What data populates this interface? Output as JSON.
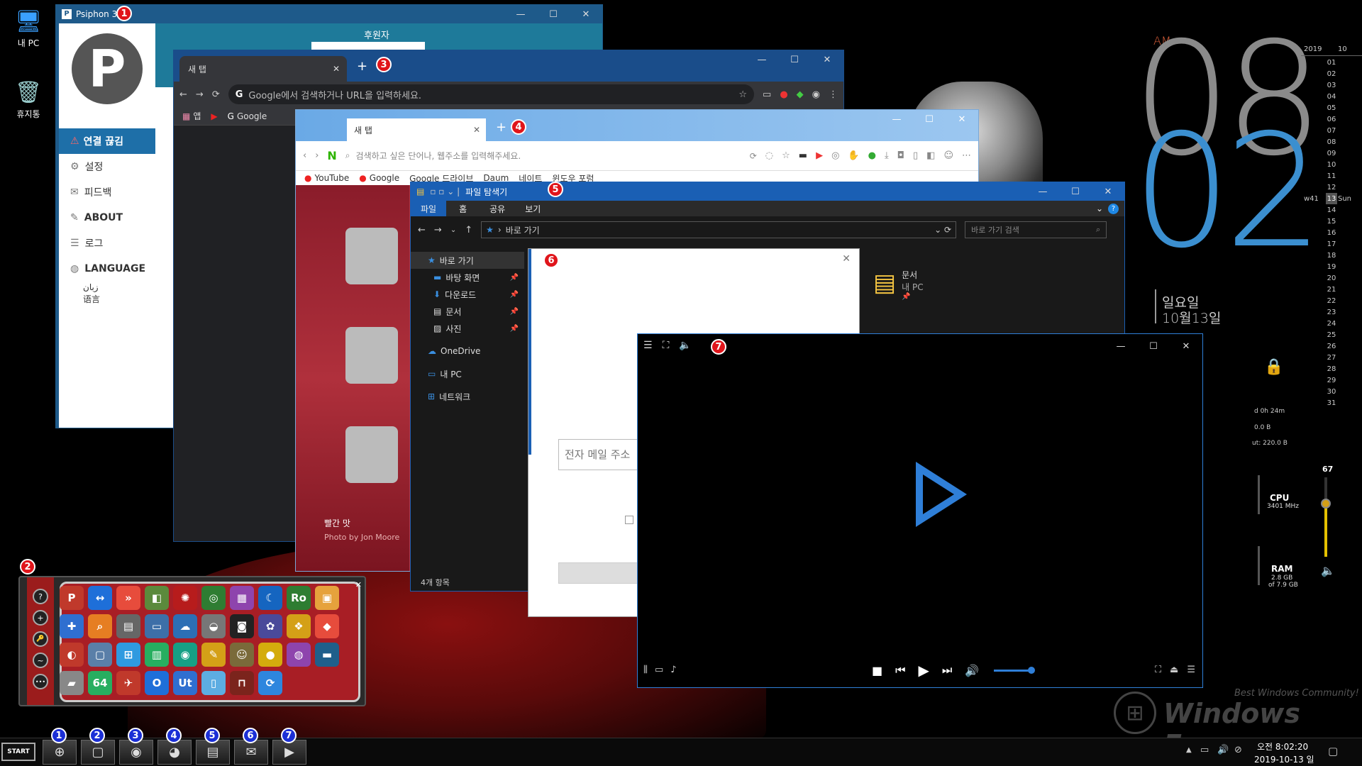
{
  "desktop": {
    "icons": [
      {
        "label": "내 PC",
        "icon": "monitor-icon"
      },
      {
        "label": "휴지통",
        "icon": "recycle-bin-icon"
      }
    ],
    "watermark": "Windows Forum",
    "watermark_sub": "Best Windows Community!"
  },
  "clock_widget": {
    "ampm": "AM",
    "hour": "08",
    "minute": "02",
    "weekday": "일요일",
    "date": "10월13일",
    "hour_color": "#8a8a8a",
    "minute_color": "#3b8fd0"
  },
  "calendar": {
    "year": "2019",
    "month": "10",
    "week": "w41",
    "today": "13",
    "today_name": "Sun",
    "days": [
      "01",
      "02",
      "03",
      "04",
      "05",
      "06",
      "07",
      "08",
      "09",
      "10",
      "11",
      "12",
      "13",
      "14",
      "15",
      "16",
      "17",
      "18",
      "19",
      "20",
      "21",
      "22",
      "23",
      "24",
      "25",
      "26",
      "27",
      "28",
      "29",
      "30",
      "31"
    ]
  },
  "sys_meters": {
    "uptime": "d 0h 24m",
    "net_in": "0.0 B",
    "net_out": "ut: 220.0 B",
    "cpu_label": "CPU",
    "cpu_freq": "3401 MHz",
    "ram_label": "RAM",
    "ram_used": "2.8 GB",
    "ram_total": "of 7.9 GB",
    "volume": "67"
  },
  "badges": {
    "psiphon": "1",
    "launcher": "2",
    "chrome": "3",
    "whale": "4",
    "explorer": "5",
    "dialog": "6",
    "player": "7"
  },
  "psiphon": {
    "title": "Psiphon 3",
    "sponsor": "후원자",
    "menu": [
      {
        "label": "연결 끊김",
        "icon": "warning-icon"
      },
      {
        "label": "설정",
        "icon": "gear-icon"
      },
      {
        "label": "피드백",
        "icon": "chat-icon"
      },
      {
        "label": "ABOUT",
        "icon": "megaphone-icon"
      },
      {
        "label": "로그",
        "icon": "list-icon"
      },
      {
        "label": "LANGUAGE",
        "icon": "globe-icon"
      }
    ],
    "lang_sub1": "زبان",
    "lang_sub2": "语言"
  },
  "chrome": {
    "tab_title": "새 탭",
    "new_tab": "+",
    "address_placeholder": "Google에서 검색하거나 URL을 입력하세요.",
    "bookmarks": [
      {
        "label": "앱",
        "icon": "apps-grid-icon"
      },
      {
        "label": "",
        "icon": "youtube-icon"
      },
      {
        "label": "Google",
        "icon": "google-icon"
      }
    ]
  },
  "whale": {
    "tab_title": "새 탭",
    "new_tab": "+",
    "address_placeholder": "검색하고 싶은 단어나, 웹주소를 입력해주세요.",
    "bookmarks": [
      "YouTube",
      "Google",
      "Google 드라이브",
      "Daum",
      "네이트",
      "윈도우 포럼"
    ],
    "photo_caption": "빨간 맛",
    "photo_credit": "Photo by Jon Moore"
  },
  "explorer": {
    "title": "파일 탐색기",
    "ribbon_tabs": [
      "파일",
      "홈",
      "공유",
      "보기"
    ],
    "address": "바로 가기",
    "search_placeholder": "바로 가기 검색",
    "sidebar": [
      {
        "label": "바로 가기",
        "icon": "star-icon",
        "pinned": false
      },
      {
        "label": "바탕 화면",
        "icon": "desktop-icon",
        "pinned": true
      },
      {
        "label": "다운로드",
        "icon": "download-icon",
        "pinned": true
      },
      {
        "label": "문서",
        "icon": "document-icon",
        "pinned": true
      },
      {
        "label": "사진",
        "icon": "picture-icon",
        "pinned": true
      },
      {
        "label": "OneDrive",
        "icon": "cloud-icon",
        "pinned": false
      },
      {
        "label": "내 PC",
        "icon": "pc-icon",
        "pinned": false
      },
      {
        "label": "네트워크",
        "icon": "network-icon",
        "pinned": false
      }
    ],
    "item_name": "문서",
    "item_sub": "내 PC",
    "status": "4개 항목"
  },
  "dialog": {
    "email_placeholder": "전자 메일 주소"
  },
  "player": {
    "accent": "#2f7fd8"
  },
  "launcher_side": [
    "?",
    "+",
    "🔑",
    "~",
    "•••"
  ],
  "launcher_apps": [
    {
      "glyph": "P",
      "color": "#c0392b"
    },
    {
      "glyph": "↔",
      "color": "#1e6fd9"
    },
    {
      "glyph": "»",
      "color": "#e74c3c"
    },
    {
      "glyph": "◧",
      "color": "#5b8a3c"
    },
    {
      "glyph": "✺",
      "color": "#b71c1c"
    },
    {
      "glyph": "◎",
      "color": "#2e7d32"
    },
    {
      "glyph": "▦",
      "color": "#8e44ad"
    },
    {
      "glyph": "☾",
      "color": "#1565c0"
    },
    {
      "glyph": "Ro",
      "color": "#2e7d32"
    },
    {
      "glyph": "▣",
      "color": "#e6a23c"
    },
    {
      "glyph": "✚",
      "color": "#2f6fd0"
    },
    {
      "glyph": "⌕",
      "color": "#e67e22"
    },
    {
      "glyph": "▤",
      "color": "#666"
    },
    {
      "glyph": "▭",
      "color": "#3d6fa8"
    },
    {
      "glyph": "☁",
      "color": "#2c6fb5"
    },
    {
      "glyph": "◒",
      "color": "#777"
    },
    {
      "glyph": "◙",
      "color": "#222"
    },
    {
      "glyph": "✿",
      "color": "#4a4a9a"
    },
    {
      "glyph": "❖",
      "color": "#d4a017"
    },
    {
      "glyph": "◆",
      "color": "#e74c3c"
    },
    {
      "glyph": "◐",
      "color": "#c0392b"
    },
    {
      "glyph": "▢",
      "color": "#5a7fa8"
    },
    {
      "glyph": "⊞",
      "color": "#2f9ae0"
    },
    {
      "glyph": "▥",
      "color": "#27ae60"
    },
    {
      "glyph": "◉",
      "color": "#16a085"
    },
    {
      "glyph": "✎",
      "color": "#d4a017"
    },
    {
      "glyph": "☺",
      "color": "#7a6a3a"
    },
    {
      "glyph": "●",
      "color": "#d4ac0d"
    },
    {
      "glyph": "◍",
      "color": "#8e44ad"
    },
    {
      "glyph": "▬",
      "color": "#1f5f8b"
    },
    {
      "glyph": "▰",
      "color": "#888"
    },
    {
      "glyph": "64",
      "color": "#27ae60"
    },
    {
      "glyph": "✈",
      "color": "#c0392b"
    },
    {
      "glyph": "O",
      "color": "#1e6fd9"
    },
    {
      "glyph": "Ut",
      "color": "#2f6fd0"
    },
    {
      "glyph": "▯",
      "color": "#5dade2"
    },
    {
      "glyph": "⊓",
      "color": "#7b241c"
    },
    {
      "glyph": "⟳",
      "color": "#2e86de"
    }
  ],
  "taskbar": {
    "start": "START",
    "buttons": [
      {
        "badge": "1",
        "icon": "globe-icon",
        "glyph": "⊕"
      },
      {
        "badge": "2",
        "icon": "window-icon",
        "glyph": "▢"
      },
      {
        "badge": "3",
        "icon": "chrome-icon",
        "glyph": "◉"
      },
      {
        "badge": "4",
        "icon": "whale-icon",
        "glyph": "◕"
      },
      {
        "badge": "5",
        "icon": "folder-icon",
        "glyph": "▤"
      },
      {
        "badge": "6",
        "icon": "mail-icon",
        "glyph": "✉"
      },
      {
        "badge": "7",
        "icon": "player-icon",
        "glyph": "▶"
      }
    ],
    "time": "오전 8:02:20",
    "date": "2019-10-13 일"
  }
}
